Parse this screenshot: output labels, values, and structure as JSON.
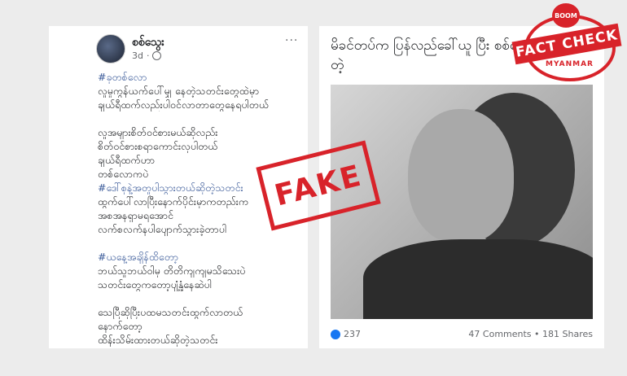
{
  "post": {
    "author": "စစ်သွေး",
    "time": "3d",
    "more_label": "···",
    "lines": [
      {
        "text": "#ခုတစ်လော",
        "type": "hashtag"
      },
      {
        "text": "လူမှုကွန်ယက်ပေါ်မျှ နေတဲ့သတင်းတွေထဲမှာ",
        "type": "text"
      },
      {
        "text": "ချယ်ရီထက်လည်းပါဝင်လာတာတွေနေရပါတယ်",
        "type": "text"
      },
      {
        "text": "",
        "type": "gap"
      },
      {
        "text": "လူအများစိတ်ဝင်စားမယ်ဆိုလည်း",
        "type": "text"
      },
      {
        "text": "စိတ်ဝင်စားစရာကောင်းလှပါတယ်",
        "type": "text"
      },
      {
        "text": "ချယ်ရီထက်ဟာ",
        "type": "text"
      },
      {
        "text": "တစ်လောကပဲ",
        "type": "text"
      },
      {
        "text": "#ဒေါ်စုနဲ့အတူပါသွားတယ်ဆိုတဲ့သတင်း",
        "type": "hashtag"
      },
      {
        "text": "ထွက်ပေါ်လာပြီးနောက်ပိုင်းမှာကတည်းက",
        "type": "text"
      },
      {
        "text": "အစအနရှာမရအောင်",
        "type": "text"
      },
      {
        "text": "လက်စလက်နပါပျောက်သွားခဲ့တာပါ",
        "type": "text"
      },
      {
        "text": "",
        "type": "gap"
      },
      {
        "text": "#ယနေ့အချိန်ထိတော့",
        "type": "hashtag"
      },
      {
        "text": "ဘယ်သူဘယ်ဝါမှ တိတိကျကျမသိသေးပဲ",
        "type": "text"
      },
      {
        "text": "သတင်းတွေကတော့ပျံ့နှံ့နေဆဲပါ",
        "type": "text"
      },
      {
        "text": "",
        "type": "gap"
      },
      {
        "text": "သေပြီဆိုပြီးပထမသတင်းထွက်လာတယ်",
        "type": "text"
      },
      {
        "text": "နောက်တော့",
        "type": "text"
      },
      {
        "text": "ထိန်းသိမ်းထားတယ်ဆိုတဲ့သတင်း",
        "type": "text"
      }
    ]
  },
  "article": {
    "headline": "မိခင်တပ်က ပြန်လည်ခေါ်ယူ ပြီး စစ်ဆေး နေတယ်တဲ့",
    "likes": "237",
    "comments_shares": "47 Comments • 181 Shares"
  },
  "stamp": {
    "label": "FAKE"
  },
  "badge": {
    "top": "BOOM",
    "middle": "FACT CHECK",
    "bottom": "MYANMAR"
  },
  "colors": {
    "hashtag": "#385898",
    "stamp": "#d8232a",
    "like": "#1877f2"
  }
}
